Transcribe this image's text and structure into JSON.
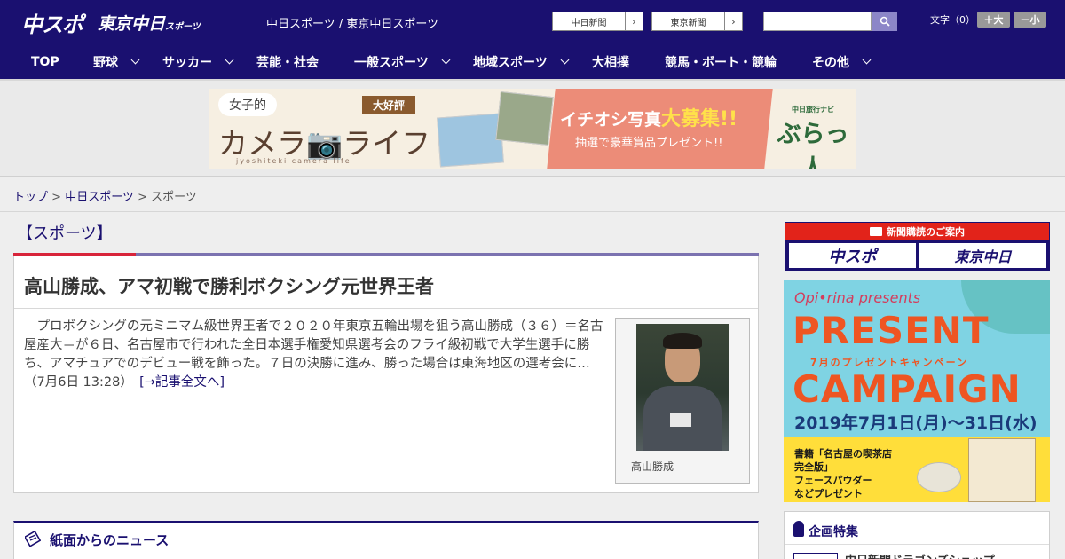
{
  "header": {
    "logo_chuspo": "中スポ",
    "logo_tokyo": "東京中日",
    "logo_tokyo_small": "スポーツ",
    "site_link": "中日スポーツ / 東京中日スポーツ",
    "newspaper_buttons": [
      "中日新聞",
      "東京新聞"
    ],
    "search_placeholder": "",
    "font_size_label": "文字（0）",
    "font_larger": "＋大",
    "font_smaller": "－小"
  },
  "nav": {
    "items": [
      "TOP",
      "野球",
      "サッカー",
      "芸能・社会",
      "一般スポーツ",
      "地域スポーツ",
      "大相撲",
      "競馬・ボート・競輪",
      "その他"
    ]
  },
  "banner": {
    "bubble": "女子的",
    "tag": "大好評",
    "title": "カメラ📷ライフ",
    "subtitle": "jyoshiteki camera life",
    "headline_pre": "イチオシ写真",
    "headline_big": "大募集!!",
    "prize": "抽選で豪華賞品プレゼント!!",
    "navi_small": "中日旅行ナビ",
    "navi_big": "ぶらっ人"
  },
  "breadcrumb": {
    "home": "トップ",
    "sep1": " > ",
    "parent": "中日スポーツ",
    "sep2": " > ",
    "current": "スポーツ"
  },
  "section": {
    "title": "【スポーツ】"
  },
  "article": {
    "headline": "高山勝成、アマ初戦で勝利ボクシング元世界王者",
    "body": "　プロボクシングの元ミニマム級世界王者で２０２０年東京五輪出場を狙う高山勝成（３６）＝名古屋産大＝が６日、名古屋市で行われた全日本選手権愛知県選考会のフライ級初戦で大学生選手に勝ち、アマチュアでのデビュー戦を飾った。７日の決勝に進み、勝った場合は東海地区の選考会に…（7月6日 13:28）",
    "more_link": "[→記事全文へ]",
    "photo_caption": "高山勝成"
  },
  "news_section": {
    "title": "紙面からのニュース"
  },
  "sidebar": {
    "subscribe_header": "新聞購読のご案内",
    "subscribe_buttons": [
      "中スポ",
      "東京中日"
    ],
    "ad": {
      "brand": "Opi•rina presents",
      "present": "PRESENT",
      "campaign_sub": "7月のプレゼントキャンペーン",
      "campaign": "CAMPAIGN",
      "date": "2019年7月1日(月)〜31日(水)",
      "product_line1": "書籍「名古屋の喫茶店",
      "product_line2": "完全版」",
      "product_line3": "フェースパウダー",
      "product_line4": "などプレゼント"
    },
    "feature_title": "企画特集",
    "feature_item": "中日新聞ドラゴンズショップ"
  },
  "colors": {
    "brand_navy": "#1a1070",
    "accent_red": "#d8243a"
  }
}
